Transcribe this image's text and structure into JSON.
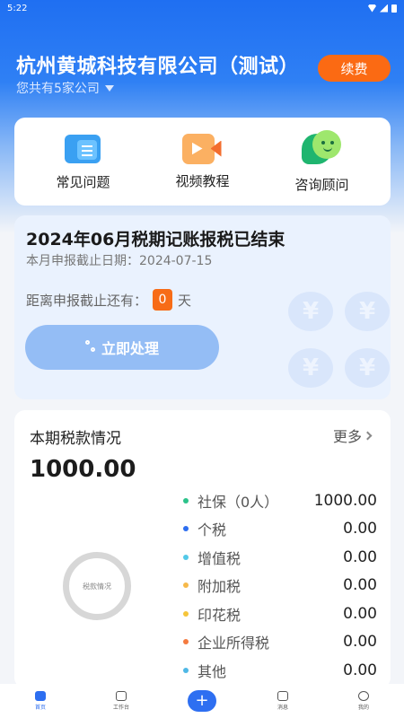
{
  "status_bar": {
    "time": "5:22"
  },
  "header": {
    "company_name": "杭州黄城科技有限公司（测试）",
    "company_count_text": "您共有5家公司",
    "renew_label": "续费"
  },
  "quick_links": [
    {
      "label": "常见问题",
      "icon": "faq-book-icon"
    },
    {
      "label": "视频教程",
      "icon": "video-camera-icon"
    },
    {
      "label": "咨询顾问",
      "icon": "consultant-chat-icon"
    }
  ],
  "period": {
    "title": "2024年06月税期记账报税已结束",
    "deadline_label": "本月申报截止日期：",
    "deadline_date": "2024-07-15",
    "remaining_label": "距离申报截止还有：",
    "remaining_days": "0",
    "remaining_unit": "天",
    "action_label": "立即处理",
    "coin_symbol": "¥"
  },
  "tax": {
    "title": "本期税款情况",
    "more_label": "更多",
    "total": "1000.00",
    "donut_label": "税款情况",
    "items": [
      {
        "name": "社保（0人）",
        "value": "1000.00",
        "color": "#2cc28a"
      },
      {
        "name": "个税",
        "value": "0.00",
        "color": "#2d6ef0"
      },
      {
        "name": "增值税",
        "value": "0.00",
        "color": "#52c9e8"
      },
      {
        "name": "附加税",
        "value": "0.00",
        "color": "#f6b94a"
      },
      {
        "name": "印花税",
        "value": "0.00",
        "color": "#f5c53a"
      },
      {
        "name": "企业所得税",
        "value": "0.00",
        "color": "#f47a3f"
      },
      {
        "name": "其他",
        "value": "0.00",
        "color": "#4fb8e6"
      }
    ]
  },
  "tabbar": {
    "tabs": [
      {
        "label": "首页",
        "active": true
      },
      {
        "label": "工作台",
        "active": false
      },
      {
        "label": "",
        "plus": "+"
      },
      {
        "label": "消息",
        "active": false
      },
      {
        "label": "我的",
        "active": false
      }
    ]
  }
}
